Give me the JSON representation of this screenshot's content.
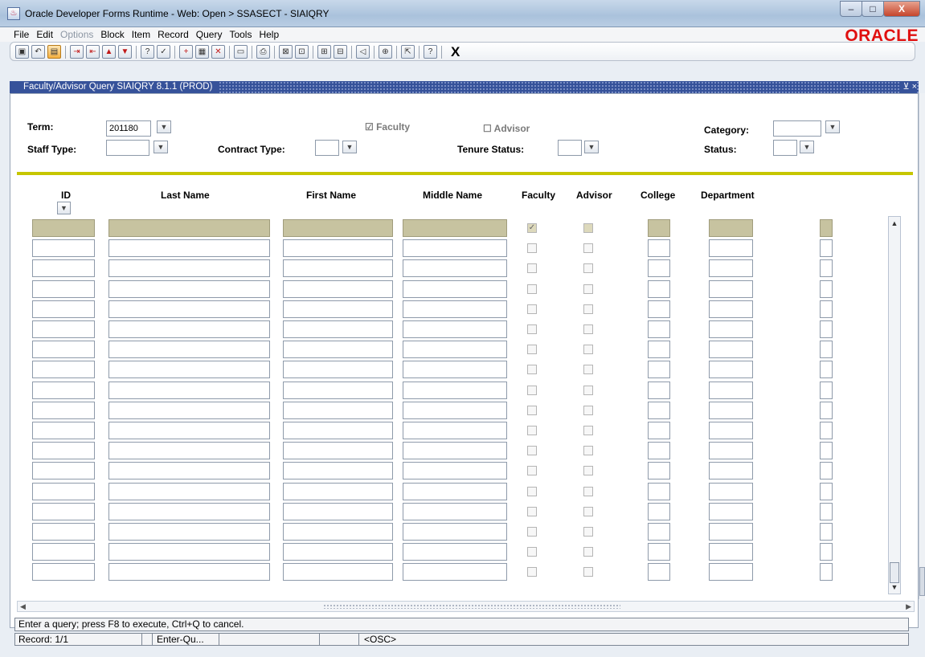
{
  "window": {
    "title": "Oracle Developer Forms Runtime - Web: Open > SSASECT - SIAIQRY",
    "minimize": "–",
    "maximize": "□",
    "close": "X"
  },
  "menu": [
    "File",
    "Edit",
    "Options",
    "Block",
    "Item",
    "Record",
    "Query",
    "Tools",
    "Help"
  ],
  "brand": "ORACLE",
  "toolbar": {
    "exit": "X"
  },
  "form": {
    "title": "Faculty/Advisor Query  SIAIQRY  8.1.1  (PROD)",
    "controls": "⊻ ×"
  },
  "key_block": {
    "term_label": "Term:",
    "term_value": "201180",
    "staff_type_label": "Staff Type:",
    "contract_type_label": "Contract Type:",
    "faculty_label": "Faculty",
    "advisor_label": "Advisor",
    "tenure_status_label": "Tenure Status:",
    "category_label": "Category:",
    "status_label": "Status:"
  },
  "columns": [
    "ID",
    "Last Name",
    "First Name",
    "Middle Name",
    "Faculty",
    "Advisor",
    "College",
    "Department"
  ],
  "rows_count": 18,
  "status": {
    "message": "Enter a query;  press F8 to execute, Ctrl+Q to cancel.",
    "record": "Record: 1/1",
    "mode": "Enter-Qu...",
    "osc": "<OSC>"
  }
}
